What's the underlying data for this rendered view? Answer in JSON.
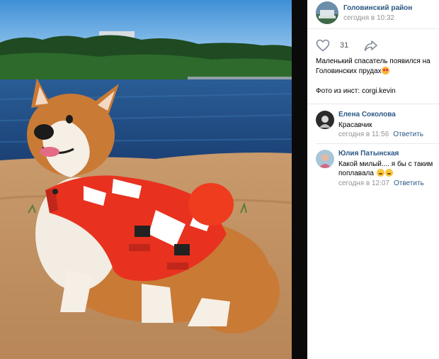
{
  "post": {
    "group_name": "Головинский район",
    "time": "сегодня в 10:32",
    "likes": "31",
    "text_line1": "Маленький спасатель появился на Головинских прудах",
    "text_source": "Фото из инст: corgi.kevin"
  },
  "comments": [
    {
      "author": "Елена Соколова",
      "text": "Красавчик",
      "time": "сегодня в 11:56",
      "reply": "Ответить"
    },
    {
      "author": "Юлия Патынская",
      "text": "Какой милый.... я бы с таким поплавала",
      "time": "сегодня в 12:07",
      "reply": "Ответить"
    }
  ],
  "icons": {
    "like": "heart-outline-icon",
    "share": "share-arrow-icon",
    "emoji_post": "heart-eyes-emoji",
    "emoji_comment": "laughing-emoji"
  },
  "colors": {
    "link": "#2a5885",
    "muted": "#939393",
    "divider": "#e7e8ec",
    "vest": "#e8321f"
  }
}
